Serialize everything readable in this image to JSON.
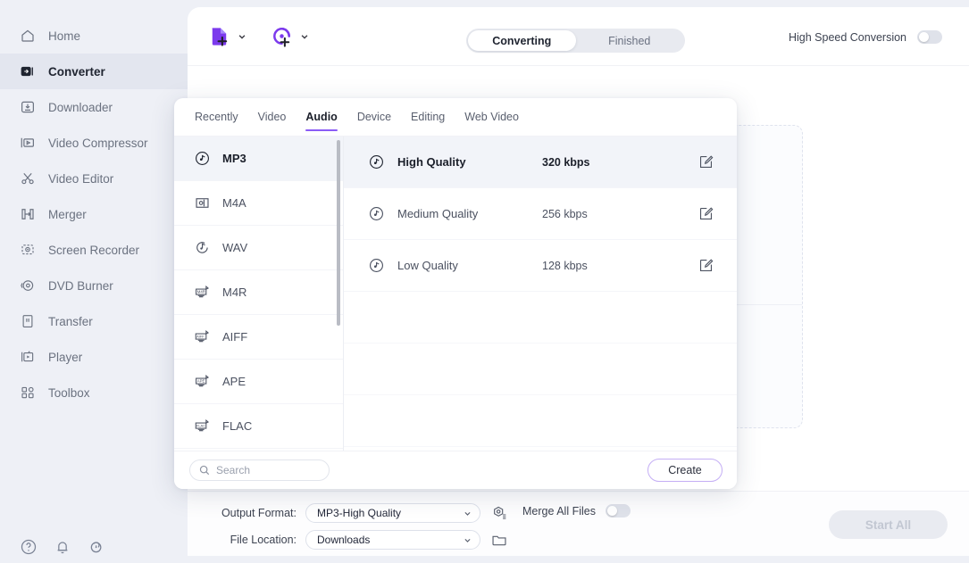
{
  "sidebar": {
    "items": [
      {
        "label": "Home",
        "icon": "home-icon",
        "active": false
      },
      {
        "label": "Converter",
        "icon": "converter-icon",
        "active": true
      },
      {
        "label": "Downloader",
        "icon": "download-icon",
        "active": false
      },
      {
        "label": "Video Compressor",
        "icon": "compress-icon",
        "active": false
      },
      {
        "label": "Video Editor",
        "icon": "scissors-icon",
        "active": false
      },
      {
        "label": "Merger",
        "icon": "merge-icon",
        "active": false
      },
      {
        "label": "Screen Recorder",
        "icon": "record-icon",
        "active": false
      },
      {
        "label": "DVD Burner",
        "icon": "disc-icon",
        "active": false
      },
      {
        "label": "Transfer",
        "icon": "transfer-icon",
        "active": false
      },
      {
        "label": "Player",
        "icon": "player-icon",
        "active": false
      },
      {
        "label": "Toolbox",
        "icon": "toolbox-icon",
        "active": false
      }
    ],
    "footer_icons": [
      {
        "name": "help-icon"
      },
      {
        "name": "bell-icon"
      },
      {
        "name": "update-icon"
      }
    ]
  },
  "header": {
    "add_file_icon": "add-file-icon",
    "add_disc_icon": "add-disc-icon",
    "dropdown_icon": "chevron-down-icon",
    "tabs": [
      {
        "label": "Converting",
        "active": true
      },
      {
        "label": "Finished",
        "active": false
      }
    ],
    "high_speed_label": "High Speed Conversion",
    "high_speed_enabled": false
  },
  "popup": {
    "tabs": [
      {
        "label": "Recently",
        "active": false
      },
      {
        "label": "Video",
        "active": false
      },
      {
        "label": "Audio",
        "active": true
      },
      {
        "label": "Device",
        "active": false
      },
      {
        "label": "Editing",
        "active": false
      },
      {
        "label": "Web Video",
        "active": false
      }
    ],
    "formats": [
      {
        "label": "MP3",
        "icon": "mp3-disc-icon",
        "active": true
      },
      {
        "label": "M4A",
        "icon": "m4a-icon",
        "active": false
      },
      {
        "label": "WAV",
        "icon": "wav-icon",
        "active": false
      },
      {
        "label": "M4R",
        "icon": "m4r-icon",
        "active": false
      },
      {
        "label": "AIFF",
        "icon": "aiff-icon",
        "active": false
      },
      {
        "label": "APE",
        "icon": "ape-icon",
        "active": false
      },
      {
        "label": "FLAC",
        "icon": "flac-icon",
        "active": false
      }
    ],
    "qualities": [
      {
        "name": "High Quality",
        "bitrate": "320 kbps",
        "active": true,
        "edit_icon": "edit-icon"
      },
      {
        "name": "Medium Quality",
        "bitrate": "256 kbps",
        "active": false,
        "edit_icon": "edit-icon"
      },
      {
        "name": "Low Quality",
        "bitrate": "128 kbps",
        "active": false,
        "edit_icon": "edit-icon"
      }
    ],
    "search": {
      "placeholder": "Search",
      "value": "",
      "icon": "search-icon"
    },
    "create_label": "Create"
  },
  "bottom": {
    "output_format_label": "Output Format:",
    "output_format_value": "MP3-High Quality",
    "output_settings_icon": "settings-hex-icon",
    "file_location_label": "File Location:",
    "file_location_value": "Downloads",
    "folder_icon": "folder-icon",
    "merge_label": "Merge All Files",
    "merge_enabled": false,
    "start_all_label": "Start All",
    "start_all_disabled": true
  },
  "colors": {
    "accent": "#8b5cf6",
    "page_bg": "#eef0f6",
    "card_bg": "#ffffff",
    "row_selected": "#f2f4f9",
    "disabled_btn": "#e9ebf1"
  }
}
